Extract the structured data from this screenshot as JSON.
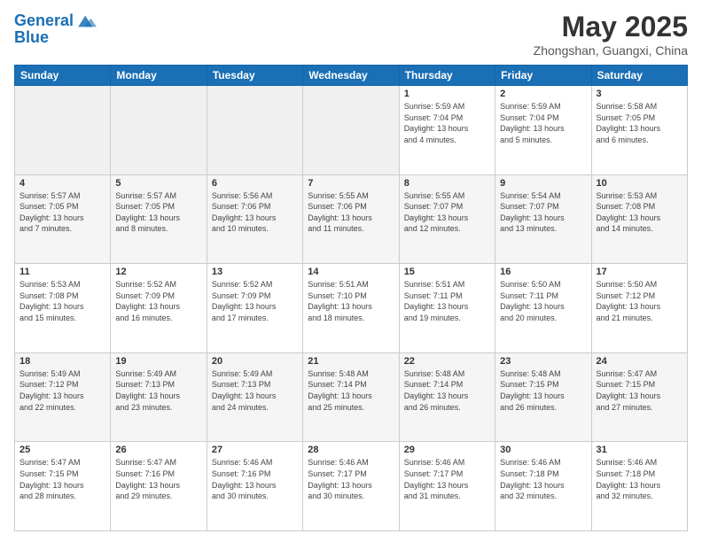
{
  "header": {
    "logo_line1": "General",
    "logo_line2": "Blue",
    "month": "May 2025",
    "location": "Zhongshan, Guangxi, China"
  },
  "weekdays": [
    "Sunday",
    "Monday",
    "Tuesday",
    "Wednesday",
    "Thursday",
    "Friday",
    "Saturday"
  ],
  "weeks": [
    [
      {
        "day": "",
        "info": "",
        "empty": true
      },
      {
        "day": "",
        "info": "",
        "empty": true
      },
      {
        "day": "",
        "info": "",
        "empty": true
      },
      {
        "day": "",
        "info": "",
        "empty": true
      },
      {
        "day": "1",
        "info": "Sunrise: 5:59 AM\nSunset: 7:04 PM\nDaylight: 13 hours\nand 4 minutes."
      },
      {
        "day": "2",
        "info": "Sunrise: 5:59 AM\nSunset: 7:04 PM\nDaylight: 13 hours\nand 5 minutes."
      },
      {
        "day": "3",
        "info": "Sunrise: 5:58 AM\nSunset: 7:05 PM\nDaylight: 13 hours\nand 6 minutes."
      }
    ],
    [
      {
        "day": "4",
        "info": "Sunrise: 5:57 AM\nSunset: 7:05 PM\nDaylight: 13 hours\nand 7 minutes."
      },
      {
        "day": "5",
        "info": "Sunrise: 5:57 AM\nSunset: 7:05 PM\nDaylight: 13 hours\nand 8 minutes."
      },
      {
        "day": "6",
        "info": "Sunrise: 5:56 AM\nSunset: 7:06 PM\nDaylight: 13 hours\nand 10 minutes."
      },
      {
        "day": "7",
        "info": "Sunrise: 5:55 AM\nSunset: 7:06 PM\nDaylight: 13 hours\nand 11 minutes."
      },
      {
        "day": "8",
        "info": "Sunrise: 5:55 AM\nSunset: 7:07 PM\nDaylight: 13 hours\nand 12 minutes."
      },
      {
        "day": "9",
        "info": "Sunrise: 5:54 AM\nSunset: 7:07 PM\nDaylight: 13 hours\nand 13 minutes."
      },
      {
        "day": "10",
        "info": "Sunrise: 5:53 AM\nSunset: 7:08 PM\nDaylight: 13 hours\nand 14 minutes."
      }
    ],
    [
      {
        "day": "11",
        "info": "Sunrise: 5:53 AM\nSunset: 7:08 PM\nDaylight: 13 hours\nand 15 minutes."
      },
      {
        "day": "12",
        "info": "Sunrise: 5:52 AM\nSunset: 7:09 PM\nDaylight: 13 hours\nand 16 minutes."
      },
      {
        "day": "13",
        "info": "Sunrise: 5:52 AM\nSunset: 7:09 PM\nDaylight: 13 hours\nand 17 minutes."
      },
      {
        "day": "14",
        "info": "Sunrise: 5:51 AM\nSunset: 7:10 PM\nDaylight: 13 hours\nand 18 minutes."
      },
      {
        "day": "15",
        "info": "Sunrise: 5:51 AM\nSunset: 7:11 PM\nDaylight: 13 hours\nand 19 minutes."
      },
      {
        "day": "16",
        "info": "Sunrise: 5:50 AM\nSunset: 7:11 PM\nDaylight: 13 hours\nand 20 minutes."
      },
      {
        "day": "17",
        "info": "Sunrise: 5:50 AM\nSunset: 7:12 PM\nDaylight: 13 hours\nand 21 minutes."
      }
    ],
    [
      {
        "day": "18",
        "info": "Sunrise: 5:49 AM\nSunset: 7:12 PM\nDaylight: 13 hours\nand 22 minutes."
      },
      {
        "day": "19",
        "info": "Sunrise: 5:49 AM\nSunset: 7:13 PM\nDaylight: 13 hours\nand 23 minutes."
      },
      {
        "day": "20",
        "info": "Sunrise: 5:49 AM\nSunset: 7:13 PM\nDaylight: 13 hours\nand 24 minutes."
      },
      {
        "day": "21",
        "info": "Sunrise: 5:48 AM\nSunset: 7:14 PM\nDaylight: 13 hours\nand 25 minutes."
      },
      {
        "day": "22",
        "info": "Sunrise: 5:48 AM\nSunset: 7:14 PM\nDaylight: 13 hours\nand 26 minutes."
      },
      {
        "day": "23",
        "info": "Sunrise: 5:48 AM\nSunset: 7:15 PM\nDaylight: 13 hours\nand 26 minutes."
      },
      {
        "day": "24",
        "info": "Sunrise: 5:47 AM\nSunset: 7:15 PM\nDaylight: 13 hours\nand 27 minutes."
      }
    ],
    [
      {
        "day": "25",
        "info": "Sunrise: 5:47 AM\nSunset: 7:15 PM\nDaylight: 13 hours\nand 28 minutes."
      },
      {
        "day": "26",
        "info": "Sunrise: 5:47 AM\nSunset: 7:16 PM\nDaylight: 13 hours\nand 29 minutes."
      },
      {
        "day": "27",
        "info": "Sunrise: 5:46 AM\nSunset: 7:16 PM\nDaylight: 13 hours\nand 30 minutes."
      },
      {
        "day": "28",
        "info": "Sunrise: 5:46 AM\nSunset: 7:17 PM\nDaylight: 13 hours\nand 30 minutes."
      },
      {
        "day": "29",
        "info": "Sunrise: 5:46 AM\nSunset: 7:17 PM\nDaylight: 13 hours\nand 31 minutes."
      },
      {
        "day": "30",
        "info": "Sunrise: 5:46 AM\nSunset: 7:18 PM\nDaylight: 13 hours\nand 32 minutes."
      },
      {
        "day": "31",
        "info": "Sunrise: 5:46 AM\nSunset: 7:18 PM\nDaylight: 13 hours\nand 32 minutes."
      }
    ]
  ]
}
